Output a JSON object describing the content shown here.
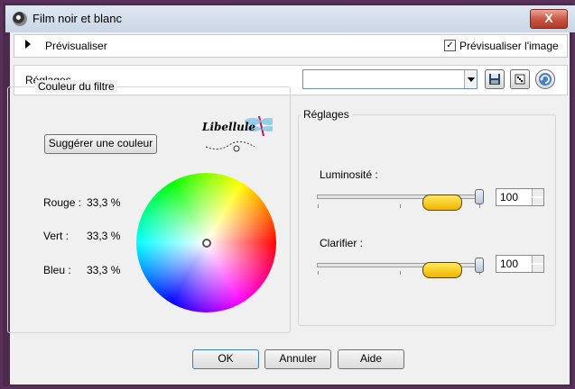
{
  "window": {
    "title": "Film noir et blanc",
    "close_glyph": "X"
  },
  "preview_bar": {
    "label": "Prévisualiser",
    "checkbox_label": "Prévisualiser l'image",
    "checkbox_checked": true,
    "check_glyph": "✓"
  },
  "reglages_bar": {
    "label": "Réglages",
    "preset_value": ""
  },
  "filter_color": {
    "group_title": "Couleur du filtre",
    "suggest_button": "Suggérer une couleur",
    "rouge_label": "Rouge :",
    "rouge_value": "33,3 %",
    "vert_label": "Vert :",
    "vert_value": "33,3 %",
    "bleu_label": "Bleu :",
    "bleu_value": "33,3 %",
    "logo_text": "Libellule"
  },
  "settings": {
    "group_title": "Réglages",
    "luminosite_label": "Luminosité :",
    "luminosite_value": "100",
    "clarifier_label": "Clarifier :",
    "clarifier_value": "100"
  },
  "buttons": {
    "ok": "OK",
    "cancel": "Annuler",
    "help": "Aide"
  },
  "colors": {
    "accent": "#c8523f",
    "window_frame": "#4b2a4b"
  }
}
